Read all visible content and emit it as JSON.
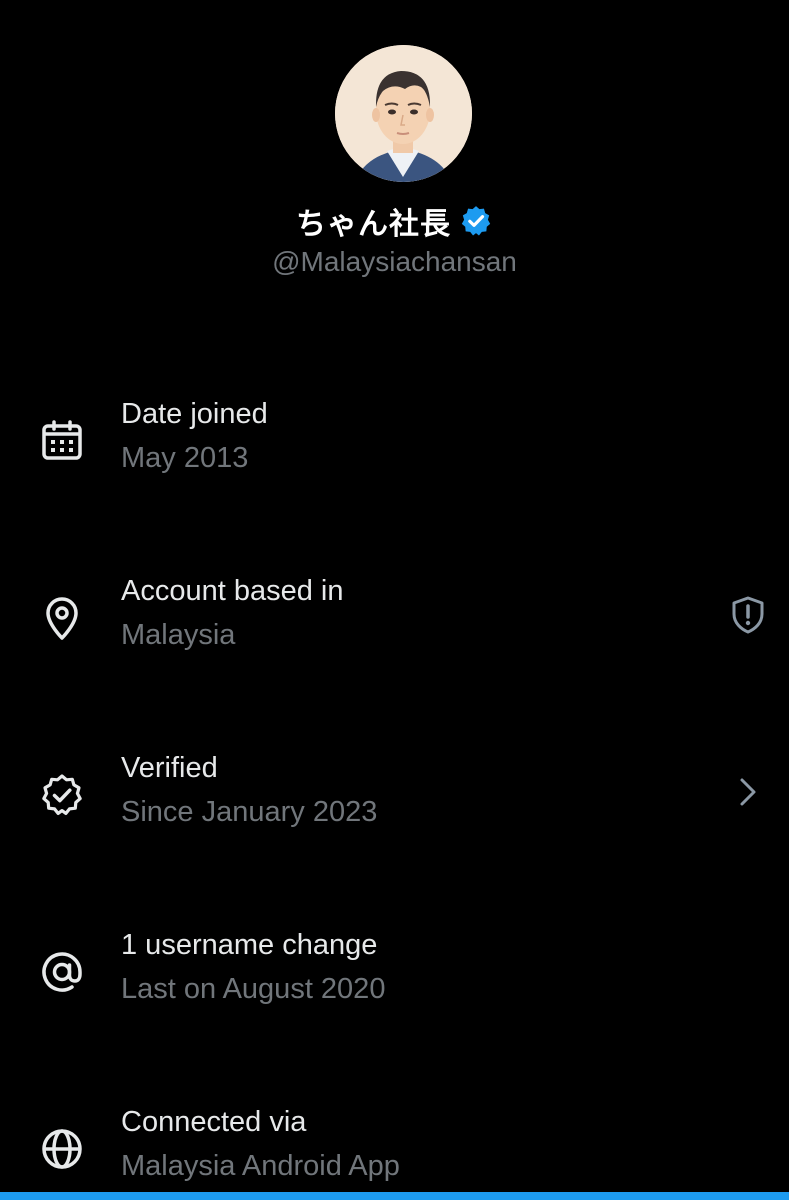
{
  "profile": {
    "display_name": "ちゃん社長",
    "handle": "@Malaysiachansan",
    "avatar_icon": "avatar-illustration",
    "verified_badge_icon": "verified-badge-icon",
    "verified_badge_color": "#1d9bf0"
  },
  "info_items": [
    {
      "icon": "calendar-icon",
      "title": "Date joined",
      "subtitle": "May 2013"
    },
    {
      "icon": "location-pin-icon",
      "title": "Account based in",
      "subtitle": "Malaysia",
      "trailing_icon": "shield-alert-icon"
    },
    {
      "icon": "verified-check-icon",
      "title": "Verified",
      "subtitle": "Since January 2023",
      "trailing_icon": "chevron-right-icon"
    },
    {
      "icon": "at-sign-icon",
      "title": "1 username change",
      "subtitle": "Last on August 2020"
    },
    {
      "icon": "globe-icon",
      "title": "Connected via",
      "subtitle": "Malaysia Android App"
    }
  ],
  "colors": {
    "background": "#000000",
    "primary_text": "#e7e9ea",
    "secondary_text": "#71767b",
    "accent": "#1d9bf0"
  }
}
